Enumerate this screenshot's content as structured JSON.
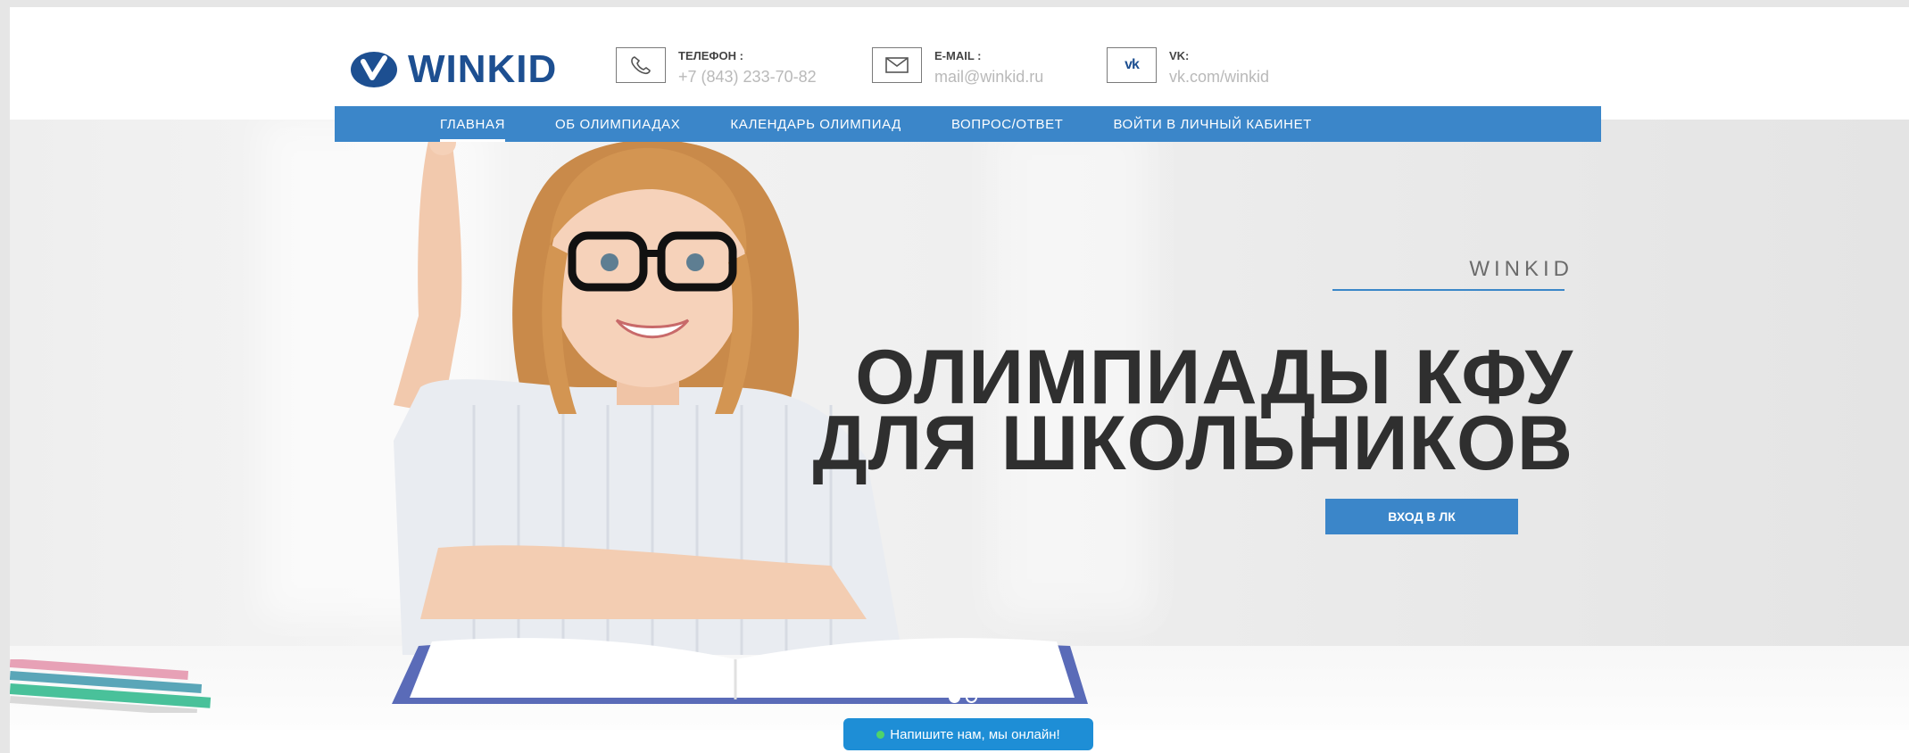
{
  "header": {
    "logo_text": "WINKID",
    "phone": {
      "title": "ТЕЛЕФОН :",
      "value": "+7 (843) 233-70-82",
      "icon": "phone-icon"
    },
    "email": {
      "title": "E-MAIL :",
      "value": "mail@winkid.ru",
      "icon": "mail-icon"
    },
    "vk": {
      "title": "VK:",
      "value": "vk.com/winkid",
      "icon": "vk-icon",
      "glyph": "vk"
    }
  },
  "nav": {
    "items": [
      {
        "label": "ГЛАВНАЯ",
        "active": true
      },
      {
        "label": "ОБ ОЛИМПИАДАХ"
      },
      {
        "label": "КАЛЕНДАРЬ ОЛИМПИАД"
      },
      {
        "label": "ВОПРОС/ОТВЕТ"
      },
      {
        "label": "ВОЙТИ В ЛИЧНЫЙ КАБИНЕТ"
      }
    ]
  },
  "hero": {
    "eyebrow": "WINKID",
    "title_line1": "ОЛИМПИАДЫ КФУ",
    "title_line2": "ДЛЯ ШКОЛЬНИКОВ",
    "cta_label": "ВХОД В ЛК",
    "slides_total": 2,
    "slide_active": 1
  },
  "chat": {
    "label": "Напишите нам, мы онлайн!"
  },
  "colors": {
    "brand_blue": "#3b86c9",
    "logo_blue": "#1d4f91",
    "chat_blue": "#1e8ed6",
    "online_green": "#4fd36a"
  }
}
